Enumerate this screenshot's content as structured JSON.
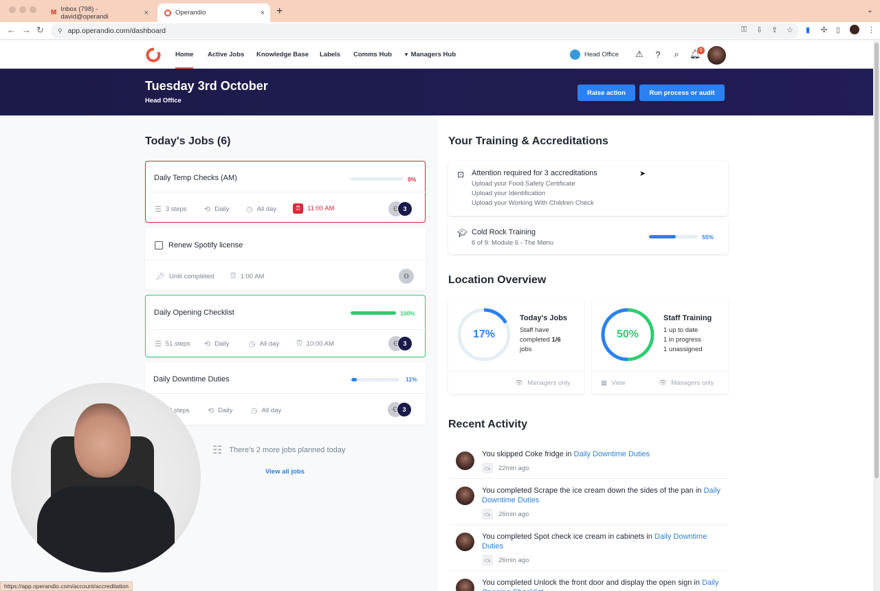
{
  "browser": {
    "tabs": [
      {
        "title": "Inbox (798) - david@operandi"
      },
      {
        "title": "Operandio"
      }
    ],
    "url": "app.operandio.com/dashboard",
    "status_url": "https://app.operandio.com/account/accreditation"
  },
  "nav": {
    "items": [
      "Home",
      "Active Jobs",
      "Knowledge Base",
      "Labels",
      "Comms Hub",
      "Managers Hub"
    ],
    "location": "Head Office",
    "notifications": "0"
  },
  "banner": {
    "date": "Tuesday 3rd October",
    "location": "Head Office",
    "raise_label": "Raise action",
    "run_label": "Run process or audit"
  },
  "jobs": {
    "heading": "Today's Jobs (6)",
    "items": [
      {
        "title": "Daily Temp Checks (AM)",
        "progress": 0,
        "pct_label": "0%",
        "steps": "3 steps",
        "repeat": "Daily",
        "when": "All day",
        "due": "11:00 AM",
        "assignees": "3"
      },
      {
        "title": "Renew Spotify license",
        "until": "Until completed",
        "due": "1:00 AM"
      },
      {
        "title": "Daily Opening Checklist",
        "progress": 100,
        "pct_label": "100%",
        "steps": "51 steps",
        "repeat": "Daily",
        "when": "All day",
        "due": "10:00 AM",
        "assignees": "3"
      },
      {
        "title": "Daily Downtime Duties",
        "progress": 11,
        "pct_label": "11%",
        "steps": "22 steps",
        "repeat": "Daily",
        "when": "All day",
        "assignees": "3"
      }
    ],
    "more_text": "There's 2 more jobs planned today",
    "view_all": "View all jobs"
  },
  "training": {
    "heading": "Your Training & Accreditations",
    "attention_title": "Attention required for 3 accreditations",
    "attention_items": [
      "Upload your Food Safety Certificate",
      "Upload your Identification",
      "Upload your Working With Children Check"
    ],
    "course_title": "Cold Rock Training",
    "course_sub": "6 of 9: Module 6 - The Menu",
    "course_progress": 55,
    "course_pct_label": "55%"
  },
  "overview": {
    "heading": "Location Overview",
    "jobs": {
      "pct": 17,
      "pct_label": "17%",
      "title": "Today's Jobs",
      "line1": "Staff have",
      "line2_pre": "completed ",
      "line2_bold": "1/6",
      "line3": "jobs",
      "footer": "Managers only"
    },
    "staff": {
      "pct": 50,
      "pct_label": "50%",
      "title": "Staff Training",
      "line1": "1 up to date",
      "line2": "1 in progress",
      "line3": "1 unassigned",
      "view": "View",
      "footer": "Managers only"
    }
  },
  "activity": {
    "heading": "Recent Activity",
    "items": [
      {
        "text": "You skipped Coke fridge in ",
        "link": "Daily Downtime Duties",
        "time": "22min ago"
      },
      {
        "text": "You completed Scrape the ice cream down the sides of the pan in ",
        "link": "Daily Downtime Duties",
        "time": "26min ago"
      },
      {
        "text": "You completed Spot check ice cream in cabinets in ",
        "link": "Daily Downtime Duties",
        "time": "26min ago"
      },
      {
        "text": "You completed Unlock the front door and display the open sign in ",
        "link": "Daily Opening Checklist",
        "time": ""
      }
    ]
  },
  "colors": {
    "accent": "#e8523a",
    "primary": "#2c80f0",
    "banner": "#1c1a4a",
    "success": "#2ecc71",
    "danger": "#d9283a"
  }
}
